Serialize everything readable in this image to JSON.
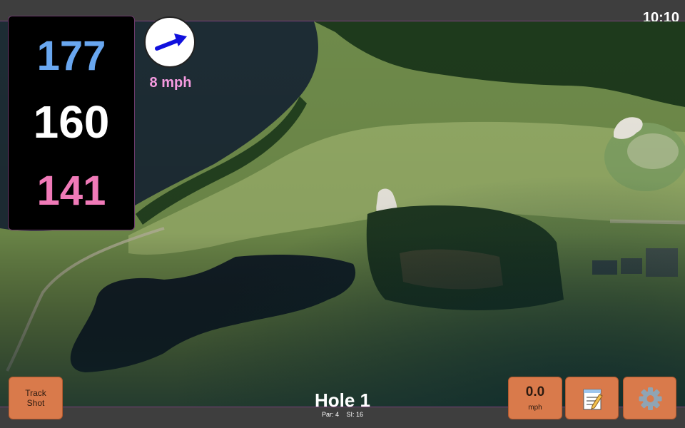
{
  "status_bar": {
    "time": "10:10"
  },
  "distances": {
    "back": "177",
    "middle": "160",
    "front": "141"
  },
  "wind": {
    "speed": "8 mph",
    "icon": "wind-arrow-icon",
    "direction": "east-northeast"
  },
  "hole": {
    "title": "Hole 1",
    "par": "Par: 4",
    "stroke_index": "SI: 16"
  },
  "buttons": {
    "track_shot": {
      "line1": "Track",
      "line2": "Shot"
    },
    "speed": {
      "value": "0.0",
      "unit": "mph"
    },
    "notes": {
      "icon": "notepad-icon"
    },
    "settings": {
      "icon": "gear-icon"
    }
  },
  "colors": {
    "back_distance": "#69a7f0",
    "middle_distance": "#ffffff",
    "front_distance": "#f07ab8",
    "wind_text": "#f59be0",
    "button": "#d97a4b",
    "bar": "#3e3e3e"
  }
}
